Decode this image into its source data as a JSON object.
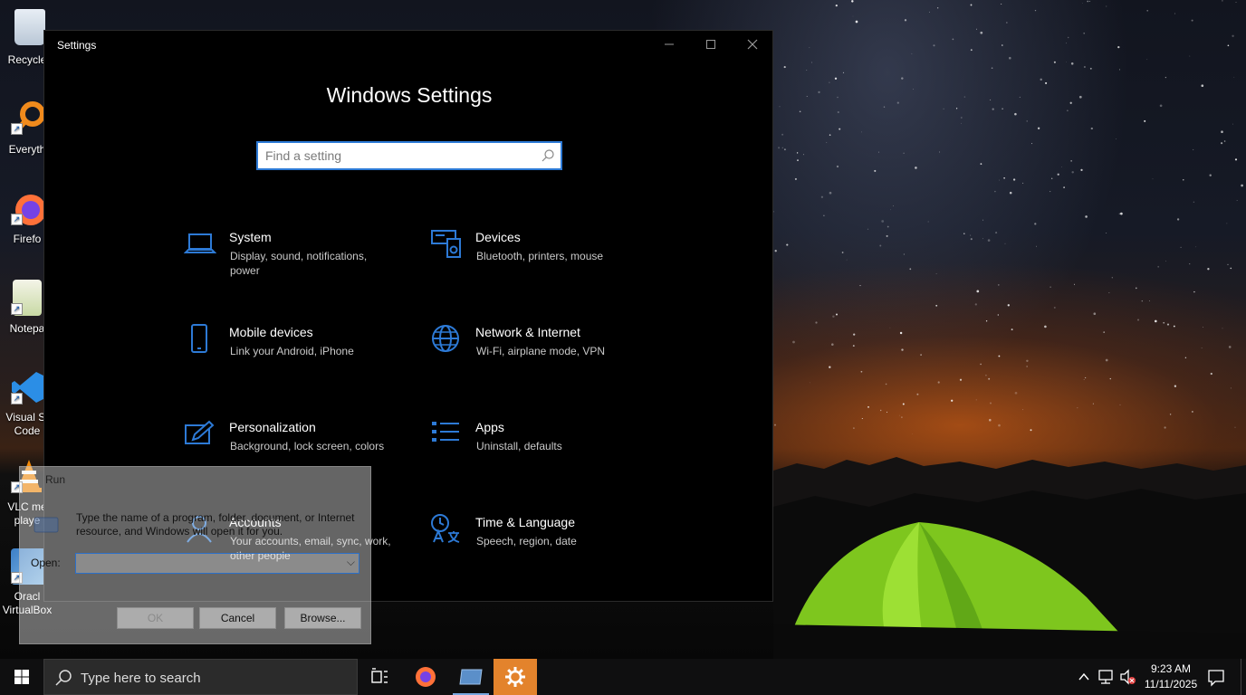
{
  "desktop": {
    "icons": [
      {
        "label": "Recycle"
      },
      {
        "label": "Everyth"
      },
      {
        "label": "Firefo"
      },
      {
        "label": "Notepa"
      },
      {
        "label": "Visual St",
        "label2": "Code"
      },
      {
        "label": "VLC me",
        "label2": "playe"
      },
      {
        "label": "Oracl",
        "label2": "VirtualBox"
      }
    ]
  },
  "settings": {
    "window_title": "Settings",
    "heading": "Windows Settings",
    "search_placeholder": "Find a setting",
    "tiles": [
      {
        "title": "System",
        "desc": "Display, sound, notifications, power",
        "icon": "laptop-icon"
      },
      {
        "title": "Devices",
        "desc": "Bluetooth, printers, mouse",
        "icon": "devices-icon"
      },
      {
        "title": "Mobile devices",
        "desc": "Link your Android, iPhone",
        "icon": "phone-icon"
      },
      {
        "title": "Network & Internet",
        "desc": "Wi-Fi, airplane mode, VPN",
        "icon": "globe-icon"
      },
      {
        "title": "Personalization",
        "desc": "Background, lock screen, colors",
        "icon": "paint-icon"
      },
      {
        "title": "Apps",
        "desc": "Uninstall, defaults",
        "icon": "apps-list-icon"
      },
      {
        "title": "Accounts",
        "desc": "Your accounts, email, sync, work, other people",
        "icon": "person-icon"
      },
      {
        "title": "Time & Language",
        "desc": "Speech, region, date",
        "icon": "time-language-icon"
      }
    ],
    "accent_color": "#2d7ad6"
  },
  "run_dialog": {
    "title": "Run",
    "description": "Type the name of a program, folder, document, or Internet resource, and Windows will open it for you.",
    "open_label": "Open:",
    "open_value": "",
    "ok_label": "OK",
    "cancel_label": "Cancel",
    "browse_label": "Browse..."
  },
  "taskbar": {
    "search_text": "Type here to search",
    "clock_time": "9:23 AM",
    "clock_date": "11/11/2025",
    "settings_accent": "#e3832c"
  }
}
